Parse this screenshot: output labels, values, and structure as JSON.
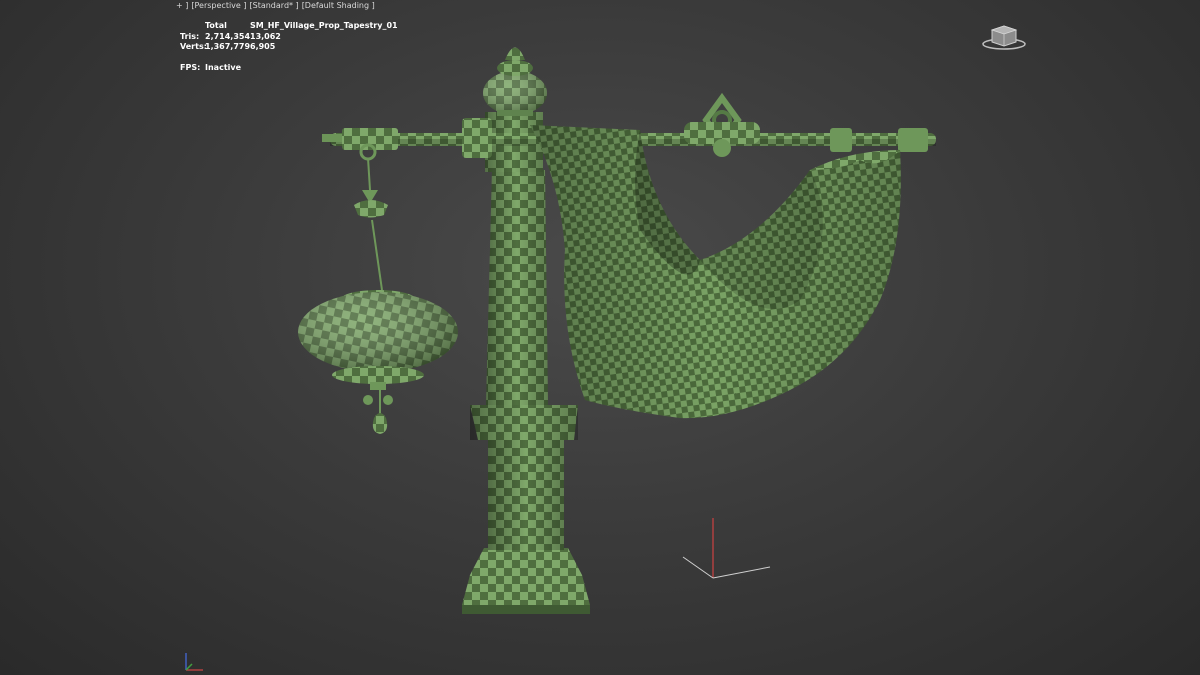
{
  "viewport": {
    "labels": [
      "+ ]",
      "[Perspective ]",
      "[Standard* ]",
      "[Default Shading ]"
    ]
  },
  "stats": {
    "header": {
      "label": "",
      "total": "Total",
      "object": "SM_HF_Village_Prop_Tapestry_01"
    },
    "tris": {
      "label": "Tris:",
      "total": "2,714,354",
      "object": "13,062"
    },
    "verts": {
      "label": "Verts:",
      "total": "1,367,779",
      "object": "6,905"
    },
    "fps": {
      "label": "FPS:",
      "value": "Inactive"
    }
  },
  "colors": {
    "checker_light": "#7fa86a",
    "checker_dark": "#4f6e3f",
    "background": "#3b3b3b",
    "gizmo_x": "#b04040",
    "gizmo_y": "#40a040",
    "gizmo_z": "#4060c0"
  },
  "icons": {
    "viewcube": "viewcube-icon",
    "world_axis": "world-axis-icon"
  }
}
